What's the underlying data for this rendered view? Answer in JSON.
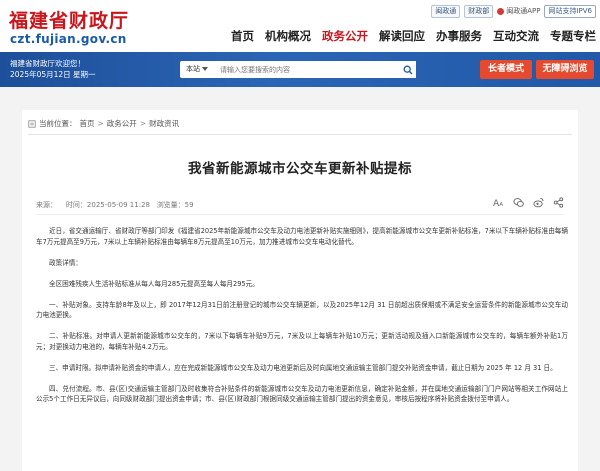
{
  "header": {
    "site_title": "福建省财政厅",
    "site_domain": "czt.fujian.gov.cn",
    "top_links": {
      "weibo": "闽政通",
      "wechat": "财政部",
      "app": "闽政通APP",
      "accessible": "闽政通APP",
      "ipv6": "网站支持IPV6"
    },
    "nav": [
      "首页",
      "机构概况",
      "政务公开",
      "解读回应",
      "办事服务",
      "互动交流",
      "专题专栏"
    ],
    "nav_active": "政务公开",
    "brand_color": "#c8161d"
  },
  "banner": {
    "welcome": "福建省财政厅欢迎您！",
    "date": "2025年05月12日 星期一",
    "search_scope": "本站",
    "search_placeholder": "请输入您要搜索的内容",
    "elder_mode": "长者模式",
    "barrier_free": "无障碍浏览",
    "banner_color": "#2159a8"
  },
  "breadcrumb": {
    "prefix": "当前位置：",
    "items": [
      "首页",
      "政务公开",
      "财政资讯"
    ]
  },
  "article": {
    "title": "我省新能源城市公交车更新补贴提标",
    "source": "来源：",
    "time": "时间：2025-05-09 11:28",
    "views": "浏览量：59",
    "paragraphs": [
      "近日，省交通运输厅、省财政厅等部门印发《福建省2025年新能源城市公交车及动力电池更新补贴实施细则》，提高新能源城市公交车更新补贴标准，7米以下车辆补贴标准由每辆车7万元提高至9万元，7米以上车辆补贴标准由每辆车8万元提高至10万元，加力推进城市公交车电动化替代。",
      "政策详情：",
      "全区困难残疾人生活补贴标准从每人每月285元提高至每人每月295元。",
      "一、补贴对象。支持车龄8年及以上，即 2017年12月31日前注册登记的城市公交车辆更新，以及2025年12月 31 日前超出质保期或不满足安全运营条件的新能源城市公交车动力电池更换。",
      "二、补贴标准。对申请人更新新能源城市公交车的，7米以下每辆车补贴9万元，7米及以上每辆车补贴10万元；更新活动规及插入口新能源城市公交车的，每辆车额外补贴1万元；对更换动力电池的，每辆车补贴4.2万元。",
      "三、申请时限。拟申请补贴资金的申请人，应在完成新能源城市公交车及动力电池更新后及时向属地交通运输主管部门提交补贴资金申请，截止日期为 2025 年 12 月 31 日。",
      "四、兑付流程。市、县(区)交通运输主管部门及时收集符合补贴条件的新能源城市公交车及动力电池更新信息，确定补贴金额，并在属地交通运输部门门户网站等相关工作网站上公示5个工作日无异议后，向同级财政部门提出资金申请；市、县(区)财政部门根据同级交通运输主管部门提出的资金意见，审核后按程序将补贴资金拨付至申请人。"
    ]
  }
}
